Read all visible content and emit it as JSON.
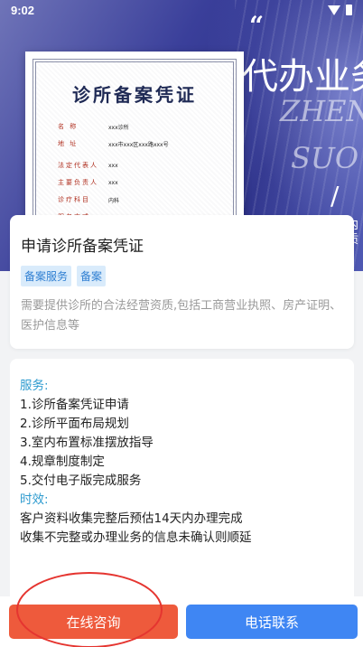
{
  "status_bar": {
    "time": "9:02"
  },
  "hero": {
    "slogan": "代办业务",
    "english_line1": "ZHEN",
    "english_line2": "SUO",
    "side_text": "内质"
  },
  "certificate": {
    "title": "诊所备案凭证",
    "rows": [
      {
        "label": "名 称",
        "value": "xxx诊所"
      },
      {
        "label": "地 址",
        "value": "xxx市xxx区xxx路xxx号"
      },
      {
        "label": "法定代表人",
        "value": "xxx"
      },
      {
        "label": "主要负责人",
        "value": "xxx"
      },
      {
        "label": "诊疗科目",
        "value": "内科"
      },
      {
        "label": "服务方式",
        "value": "xxx"
      }
    ]
  },
  "info": {
    "title": "申请诊所备案凭证",
    "tags": [
      "备案服务",
      "备案"
    ],
    "description": "需要提供诊所的合法经营资质,包括工商营业执照、房产证明、医护信息等"
  },
  "detail": {
    "services_heading": "服务:",
    "services": [
      "1.诊所备案凭证申请",
      "2.诊所平面布局规划",
      "3.室内布置标准摆放指导",
      "4.规章制度制定",
      "5.交付电子版完成服务"
    ],
    "timing_heading": "时效:",
    "timing": [
      "客户资料收集完整后预估14天内办理完成",
      "收集不完整或办理业务的信息未确认则顺延"
    ]
  },
  "actions": {
    "consult_label": "在线咨询",
    "phone_label": "电话联系"
  },
  "colors": {
    "consult": "#ee5a3c",
    "phone": "#3f86f3",
    "tag_bg": "#d9ebfb",
    "tag_text": "#2f7fd2",
    "section_heading": "#2e9bcf"
  }
}
